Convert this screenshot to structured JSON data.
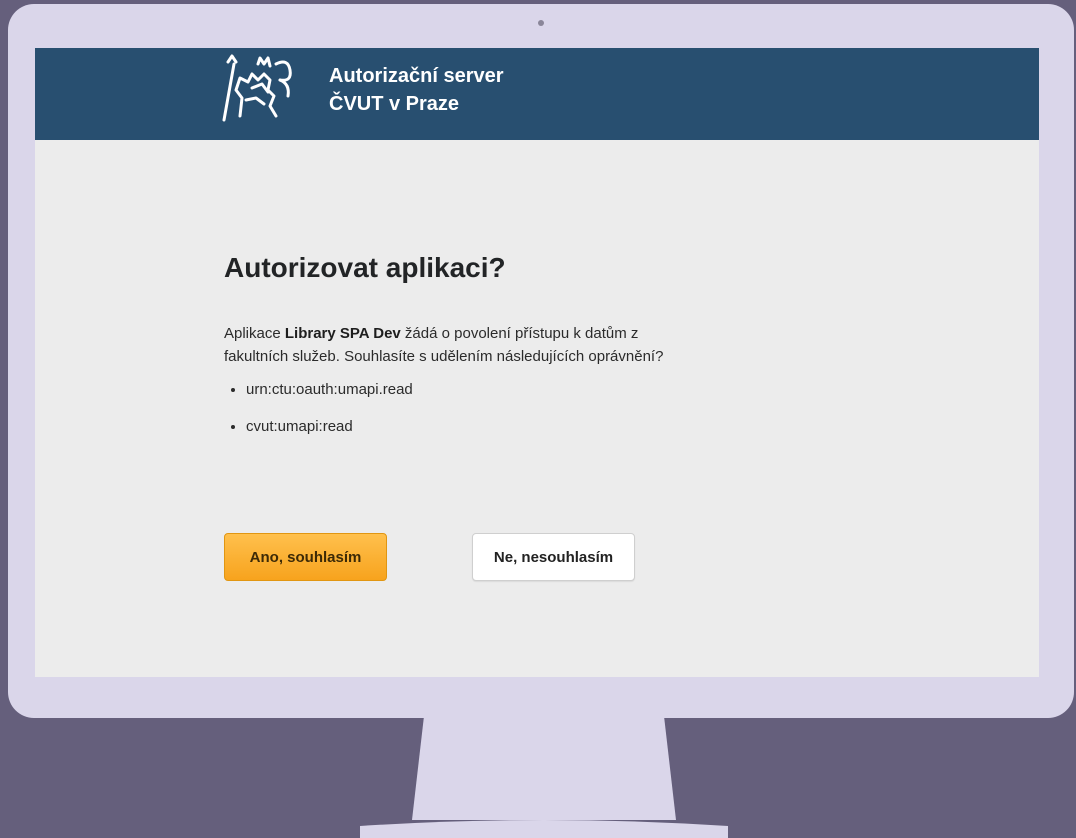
{
  "header": {
    "title_line1": "Autorizační server",
    "title_line2": "ČVUT v Praze",
    "logo_icon": "ctu-lion-logo-icon"
  },
  "main": {
    "heading": "Autorizovat aplikaci?",
    "intro_prefix": "Aplikace ",
    "app_name": "Library SPA Dev",
    "intro_suffix": " žádá o povolení přístupu k datům z fakultních služeb. Souhlasíte s udělením následujících oprávnění?",
    "scopes": [
      "urn:ctu:oauth:umapi.read",
      "cvut:umapi:read"
    ]
  },
  "actions": {
    "accept_label": "Ano, souhlasím",
    "decline_label": "Ne, nesouhlasím"
  },
  "colors": {
    "header_bg": "#284f70",
    "page_bg": "#ececec",
    "accept_button": "#f7a31d",
    "monitor_bezel": "#dad6ea",
    "backdrop": "#655f7c"
  }
}
